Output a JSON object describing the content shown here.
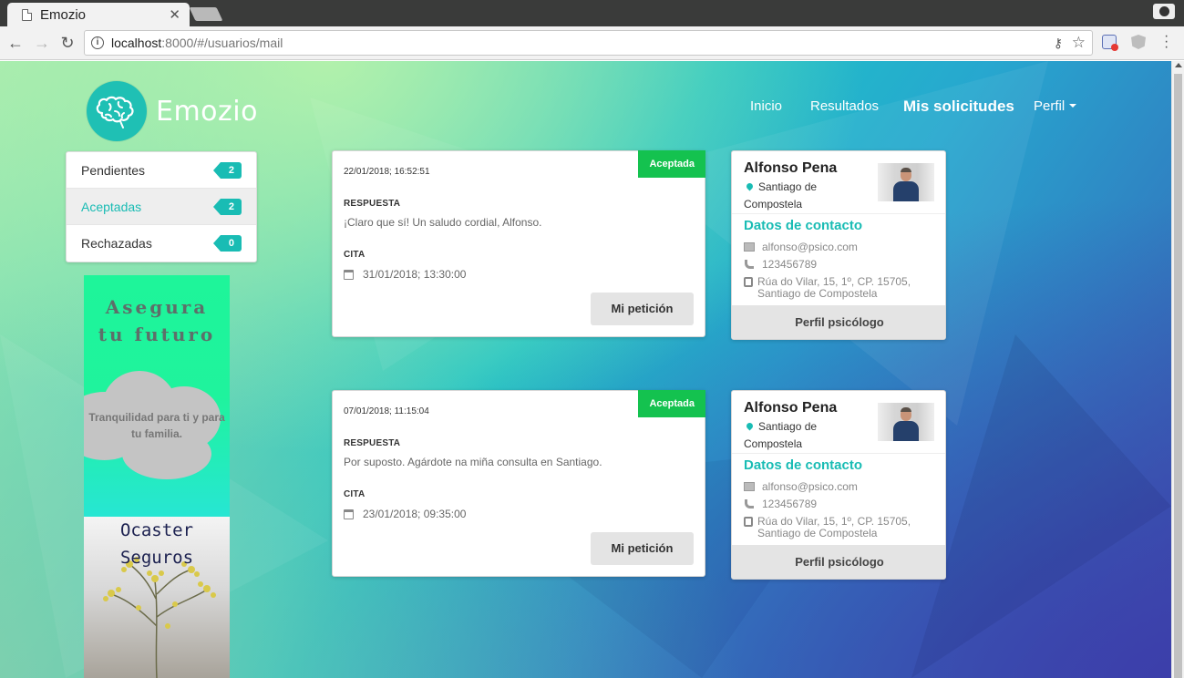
{
  "browser": {
    "tab_title": "Emozio",
    "url_host": "localhost",
    "url_path": ":8000/#/usuarios/mail"
  },
  "navbar": {
    "logo_text": "Emozio",
    "links": [
      "Inicio",
      "Resultados",
      "Mis solicitudes",
      "Perfil"
    ],
    "active": "Mis solicitudes"
  },
  "filters": [
    {
      "label": "Pendientes",
      "count": "2",
      "selected": false
    },
    {
      "label": "Aceptadas",
      "count": "2",
      "selected": true
    },
    {
      "label": "Rechazadas",
      "count": "0",
      "selected": false
    }
  ],
  "ad": {
    "heading_line1": "Asegura",
    "heading_line2": "tu futuro",
    "cloud_text": "Tranquilidad para ti y para tu familia.",
    "brand_line1": "Ocaster",
    "brand_line2": "Seguros"
  },
  "requests": [
    {
      "status": "Aceptada",
      "date": "22/01/2018; 16:52:51",
      "response_label": "RESPUESTA",
      "response_text": "¡Claro que sí! Un saludo cordial, Alfonso.",
      "cita_label": "CITA",
      "cita_date": "31/01/2018; 13:30:00",
      "button": "Mi petición",
      "psychologist": {
        "name": "Alfonso Pena",
        "location": "Santiago de Compostela",
        "contact_title": "Datos de contacto",
        "email": "alfonso@psico.com",
        "phone": "123456789",
        "address": "Rúa do Vilar, 15, 1º, CP. 15705, Santiago de Compostela",
        "footer": "Perfil psicólogo"
      }
    },
    {
      "status": "Aceptada",
      "date": "07/01/2018; 11:15:04",
      "response_label": "RESPUESTA",
      "response_text": "Por suposto. Agárdote na miña consulta en Santiago.",
      "cita_label": "CITA",
      "cita_date": "23/01/2018; 09:35:00",
      "button": "Mi petición",
      "psychologist": {
        "name": "Alfonso Pena",
        "location": "Santiago de Compostela",
        "contact_title": "Datos de contacto",
        "email": "alfonso@psico.com",
        "phone": "123456789",
        "address": "Rúa do Vilar, 15, 1º, CP. 15705, Santiago de Compostela",
        "footer": "Perfil psicólogo"
      }
    }
  ]
}
